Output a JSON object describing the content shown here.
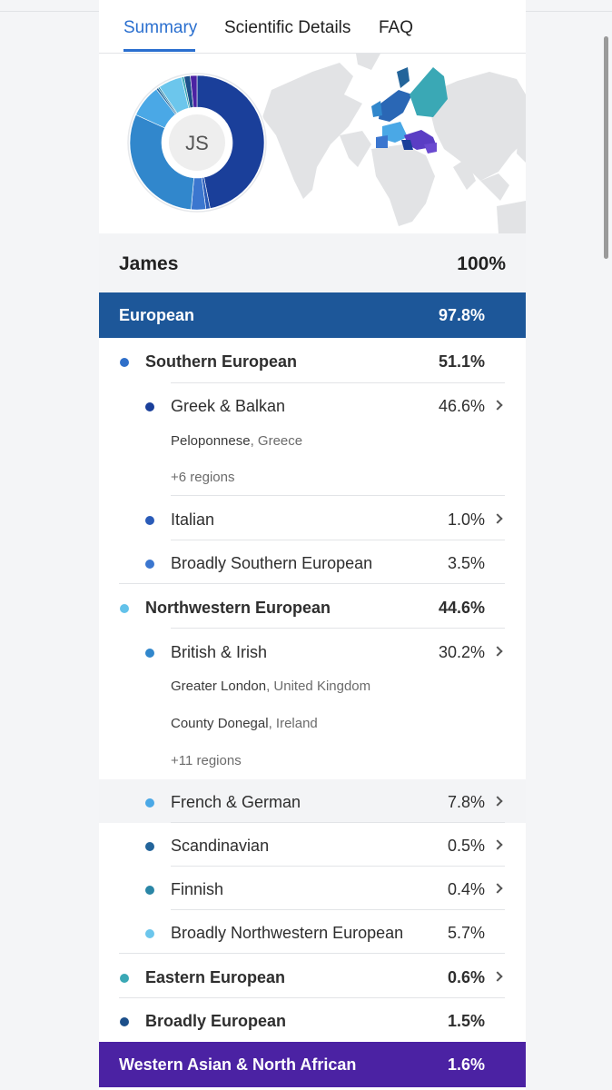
{
  "tabs": [
    {
      "label": "Summary",
      "active": true
    },
    {
      "label": "Scientific Details",
      "active": false
    },
    {
      "label": "FAQ",
      "active": false
    }
  ],
  "profile": {
    "initials": "JS",
    "name": "James",
    "total": "100%"
  },
  "colors": {
    "european_band": "#1d5799",
    "wana_band": "#4b22a3",
    "accent": "#2a6fcf",
    "greek_balkan": "#1a3f9a",
    "italian": "#2a5bb8",
    "broadly_southern": "#3b76cf",
    "southern_european": "#2f6fc9",
    "northwestern_european": "#63c2ea",
    "british_irish": "#3187cc",
    "french_german": "#4aa8e6",
    "scandinavian": "#23649a",
    "finnish": "#2a86a6",
    "broadly_northwestern": "#6cc6ec",
    "eastern_european": "#3aa8b5",
    "broadly_european": "#1c4f8a"
  },
  "european": {
    "label": "European",
    "pct": "97.8%"
  },
  "southern": {
    "label": "Southern European",
    "pct": "51.1%",
    "greek": {
      "label": "Greek & Balkan",
      "pct": "46.6%",
      "place1": "Peloponnese",
      "country1": ", Greece",
      "more": "+6 regions"
    },
    "italian": {
      "label": "Italian",
      "pct": "1.0%"
    },
    "broad": {
      "label": "Broadly Southern European",
      "pct": "3.5%"
    }
  },
  "northwestern": {
    "label": "Northwestern European",
    "pct": "44.6%",
    "british": {
      "label": "British & Irish",
      "pct": "30.2%",
      "place1": "Greater London",
      "country1": ", United Kingdom",
      "place2": "County Donegal",
      "country2": ", Ireland",
      "more": "+11 regions"
    },
    "french": {
      "label": "French & German",
      "pct": "7.8%"
    },
    "scandinavian": {
      "label": "Scandinavian",
      "pct": "0.5%"
    },
    "finnish": {
      "label": "Finnish",
      "pct": "0.4%"
    },
    "broad": {
      "label": "Broadly Northwestern European",
      "pct": "5.7%"
    }
  },
  "eastern": {
    "label": "Eastern European",
    "pct": "0.6%"
  },
  "broad_european": {
    "label": "Broadly European",
    "pct": "1.5%"
  },
  "wana": {
    "label": "Western Asian & North African",
    "pct": "1.6%"
  }
}
